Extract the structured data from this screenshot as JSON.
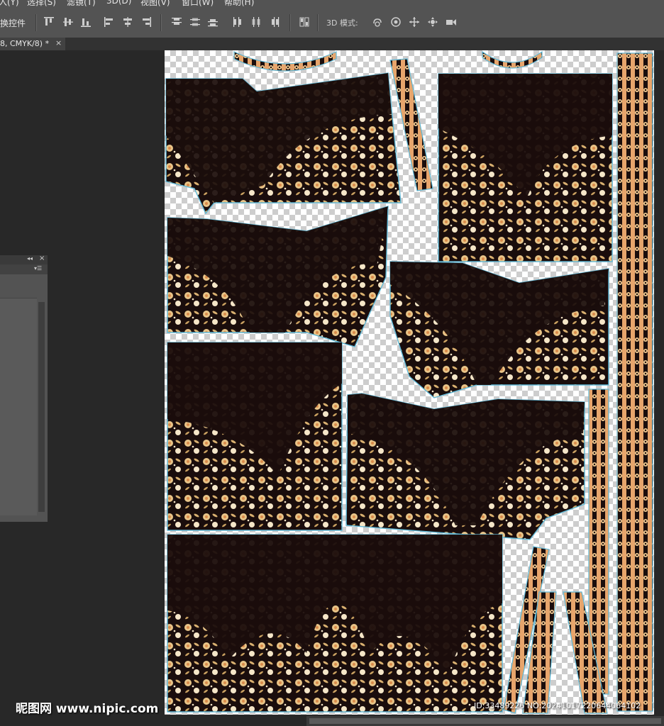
{
  "menu": {
    "items": [
      "入(Y)",
      "选择(S)",
      "滤镜(T)",
      "3D(D)",
      "视图(V)",
      "窗口(W)",
      "帮助(H)"
    ]
  },
  "options_bar": {
    "transform_controls_label": "换控件",
    "mode_3d_label": "3D 模式:"
  },
  "document_tab": {
    "title": "8, CMYK/8) *",
    "close": "×"
  },
  "panel": {
    "collapse": "◂◂",
    "close": "×",
    "menu": "▾☰"
  },
  "watermark": {
    "site": "昵图网 www.nipic.com",
    "id": "ID:33489226 NO:20241017220644064102"
  },
  "colors": {
    "fabric": "#1a0d0c",
    "floral_main": "#e8c488",
    "floral_light": "#f5e6c8",
    "floral_accent": "#d98a4a",
    "border_band": "#e7a56c",
    "cut_outline": "#5fb8d6"
  },
  "icons": [
    "align-top-edges-icon",
    "align-vertical-centers-icon",
    "align-bottom-edges-icon",
    "align-left-edges-icon",
    "align-horizontal-centers-icon",
    "align-right-edges-icon",
    "distribute-top-icon",
    "distribute-vertical-centers-icon",
    "distribute-bottom-icon",
    "distribute-left-icon",
    "distribute-horizontal-centers-icon",
    "distribute-right-icon",
    "auto-align-icon",
    "rotate-3d-icon",
    "roll-3d-icon",
    "drag-3d-icon",
    "slide-3d-icon",
    "scale-3d-icon"
  ]
}
